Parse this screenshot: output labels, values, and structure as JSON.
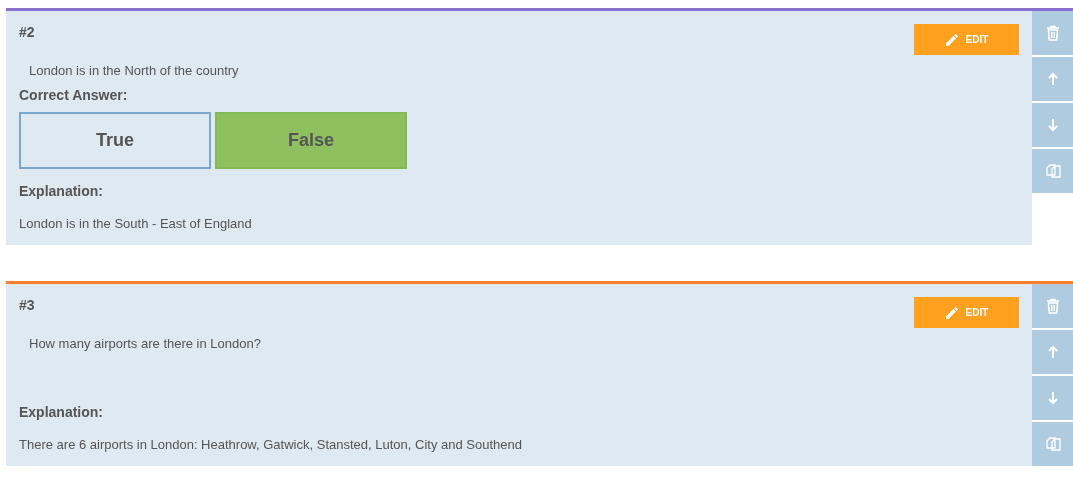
{
  "questions": [
    {
      "number": "#2",
      "color": "#8a6fd0",
      "edit_label": "EDIT",
      "question": "London is in the North of the country",
      "answer_heading": "Correct Answer:",
      "options": [
        {
          "label": "True",
          "selected": false
        },
        {
          "label": "False",
          "selected": true
        }
      ],
      "explanation_heading": "Explanation:",
      "explanation": "London is in the South - East of England"
    },
    {
      "number": "#3",
      "color": "#ff7f2a",
      "edit_label": "EDIT",
      "question": "How many airports are there in London?",
      "explanation_heading": "Explanation:",
      "explanation": "There are 6 airports in London: Heathrow, Gatwick, Stansted, Luton, City and Southend"
    }
  ]
}
